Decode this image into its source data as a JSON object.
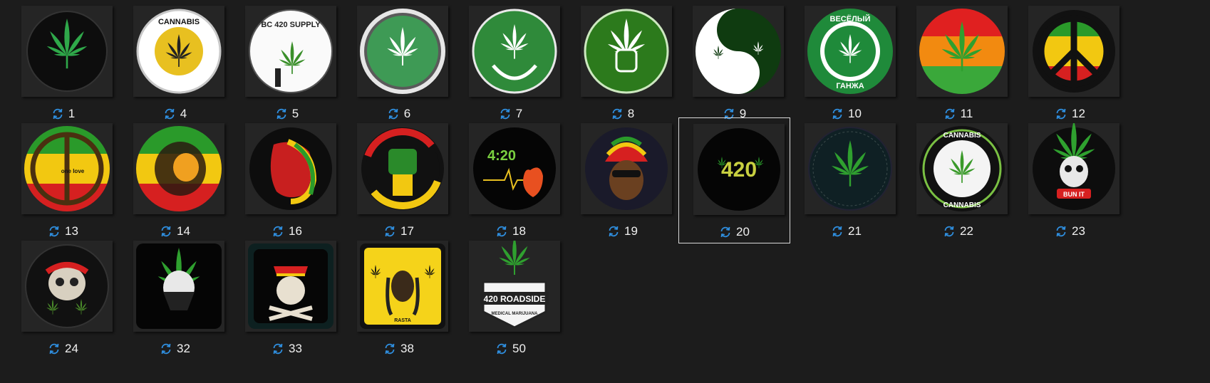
{
  "accent_color": "#2f8fe0",
  "selected_index": 20,
  "items": [
    {
      "label": "1",
      "icon": "green-leaf-dripping-icon"
    },
    {
      "label": "4",
      "icon": "cannabis-rasta-badge-icon"
    },
    {
      "label": "5",
      "icon": "bc-420-supply-icon"
    },
    {
      "label": "6",
      "icon": "white-leaf-green-circle-icon"
    },
    {
      "label": "7",
      "icon": "leaf-in-hands-icon"
    },
    {
      "label": "8",
      "icon": "fist-leaf-icon"
    },
    {
      "label": "9",
      "icon": "yin-yang-leaf-icon"
    },
    {
      "label": "10",
      "icon": "veselyi-ganja-badge-icon"
    },
    {
      "label": "11",
      "icon": "leaf-rasta-stripes-icon"
    },
    {
      "label": "12",
      "icon": "peace-sign-rasta-icon"
    },
    {
      "label": "13",
      "icon": "peace-one-love-icon"
    },
    {
      "label": "14",
      "icon": "rasta-lion-icon"
    },
    {
      "label": "16",
      "icon": "lion-head-dark-icon"
    },
    {
      "label": "17",
      "icon": "raised-fist-icon"
    },
    {
      "label": "18",
      "icon": "420-heart-icon"
    },
    {
      "label": "19",
      "icon": "rasta-man-icon"
    },
    {
      "label": "20",
      "icon": "420-text-icon"
    },
    {
      "label": "21",
      "icon": "green-leaf-dark-icon"
    },
    {
      "label": "22",
      "icon": "cannabis-ring-badge-icon"
    },
    {
      "label": "23",
      "icon": "skull-leaf-bun-it-icon"
    },
    {
      "label": "24",
      "icon": "skull-smoke-icon"
    },
    {
      "label": "32",
      "icon": "bandana-skull-icon"
    },
    {
      "label": "33",
      "icon": "rasta-skull-crossbones-icon"
    },
    {
      "label": "38",
      "icon": "rasta-portrait-icon"
    },
    {
      "label": "50",
      "icon": "420-roadside-icon"
    }
  ],
  "texts": {
    "bc420": "BC 420 SUPPLY",
    "cannabis": "CANNABIS",
    "veselyi": "ВЕСЁЛЫЙ",
    "ganja": "ГАНЖА",
    "one_love": "one love",
    "t420": "4:20",
    "n420": "420",
    "bun_it": "BUN IT",
    "rasta": "RASTA",
    "roadside": "420 ROADSIDE",
    "medical": "MEDICAL MARIJUANA"
  }
}
